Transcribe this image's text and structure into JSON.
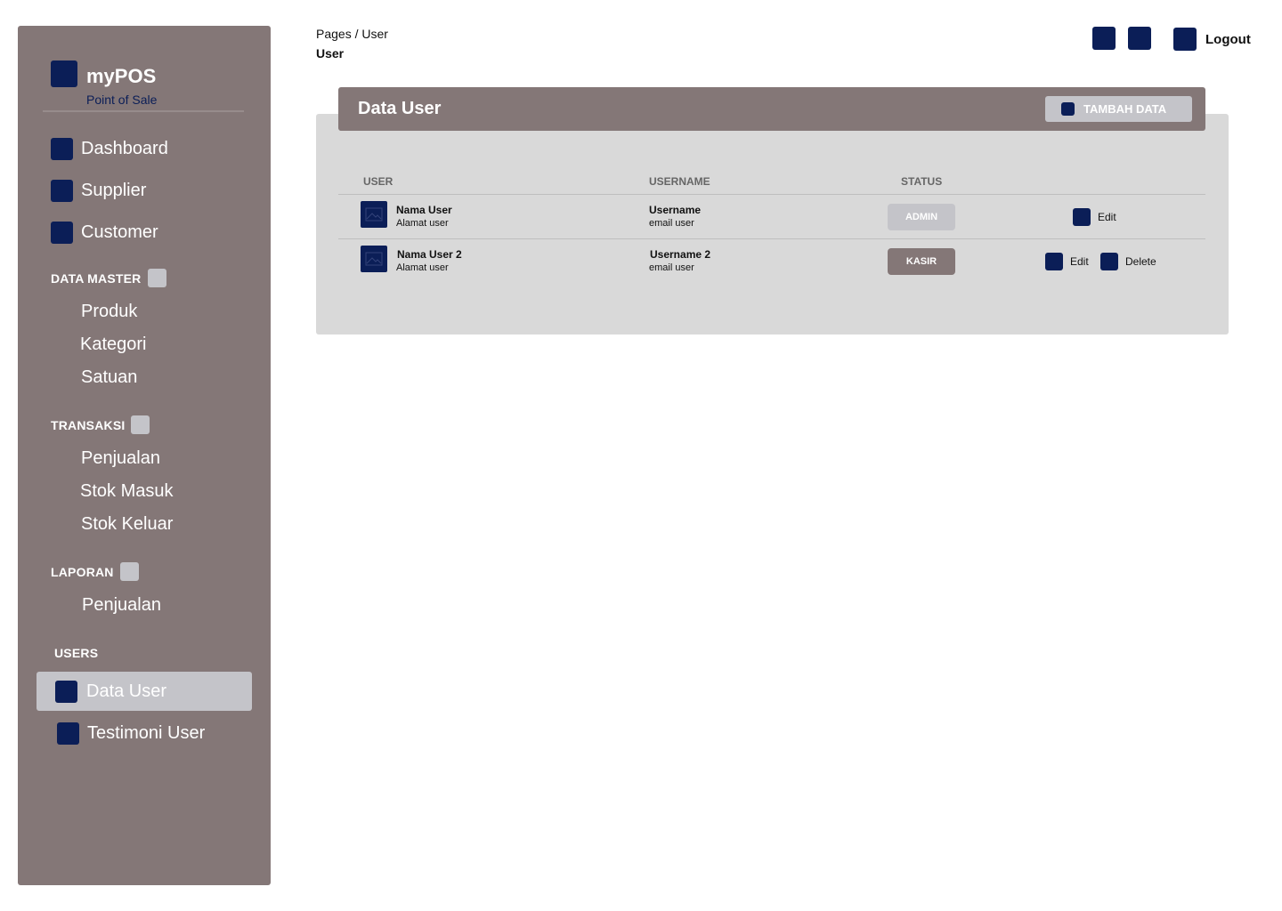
{
  "brand": {
    "title": "myPOS",
    "subtitle": "Point of Sale"
  },
  "nav": {
    "dashboard": "Dashboard",
    "supplier": "Supplier",
    "customer": "Customer"
  },
  "sections": {
    "data_master": {
      "label": "DATA MASTER",
      "items": [
        "Produk",
        "Kategori",
        "Satuan"
      ]
    },
    "transaksi": {
      "label": "TRANSAKSI",
      "items": [
        "Penjualan",
        "Stok Masuk",
        "Stok Keluar"
      ]
    },
    "laporan": {
      "label": "LAPORAN",
      "items": [
        "Penjualan"
      ]
    },
    "users": {
      "label": "USERS",
      "items": [
        "Data User",
        "Testimoni User"
      ]
    }
  },
  "header": {
    "breadcrumb": "Pages / User",
    "title": "User",
    "logout": "Logout"
  },
  "card": {
    "title": "Data User",
    "add_button": "TAMBAH DATA",
    "columns": [
      "USER",
      "USERNAME",
      "STATUS"
    ],
    "rows": [
      {
        "name": "Nama User",
        "address": "Alamat user",
        "username": "Username",
        "email": "email user",
        "status": "ADMIN",
        "edit": "Edit"
      },
      {
        "name": "Nama User 2",
        "address": "Alamat user",
        "username": "Username 2",
        "email": "email user",
        "status": "KASIR",
        "edit": "Edit",
        "delete": "Delete"
      }
    ]
  },
  "colors": {
    "sidebar": "#847777",
    "accent": "#0b1e57",
    "light": "#c4c4c9",
    "card": "#d9d9d9"
  }
}
